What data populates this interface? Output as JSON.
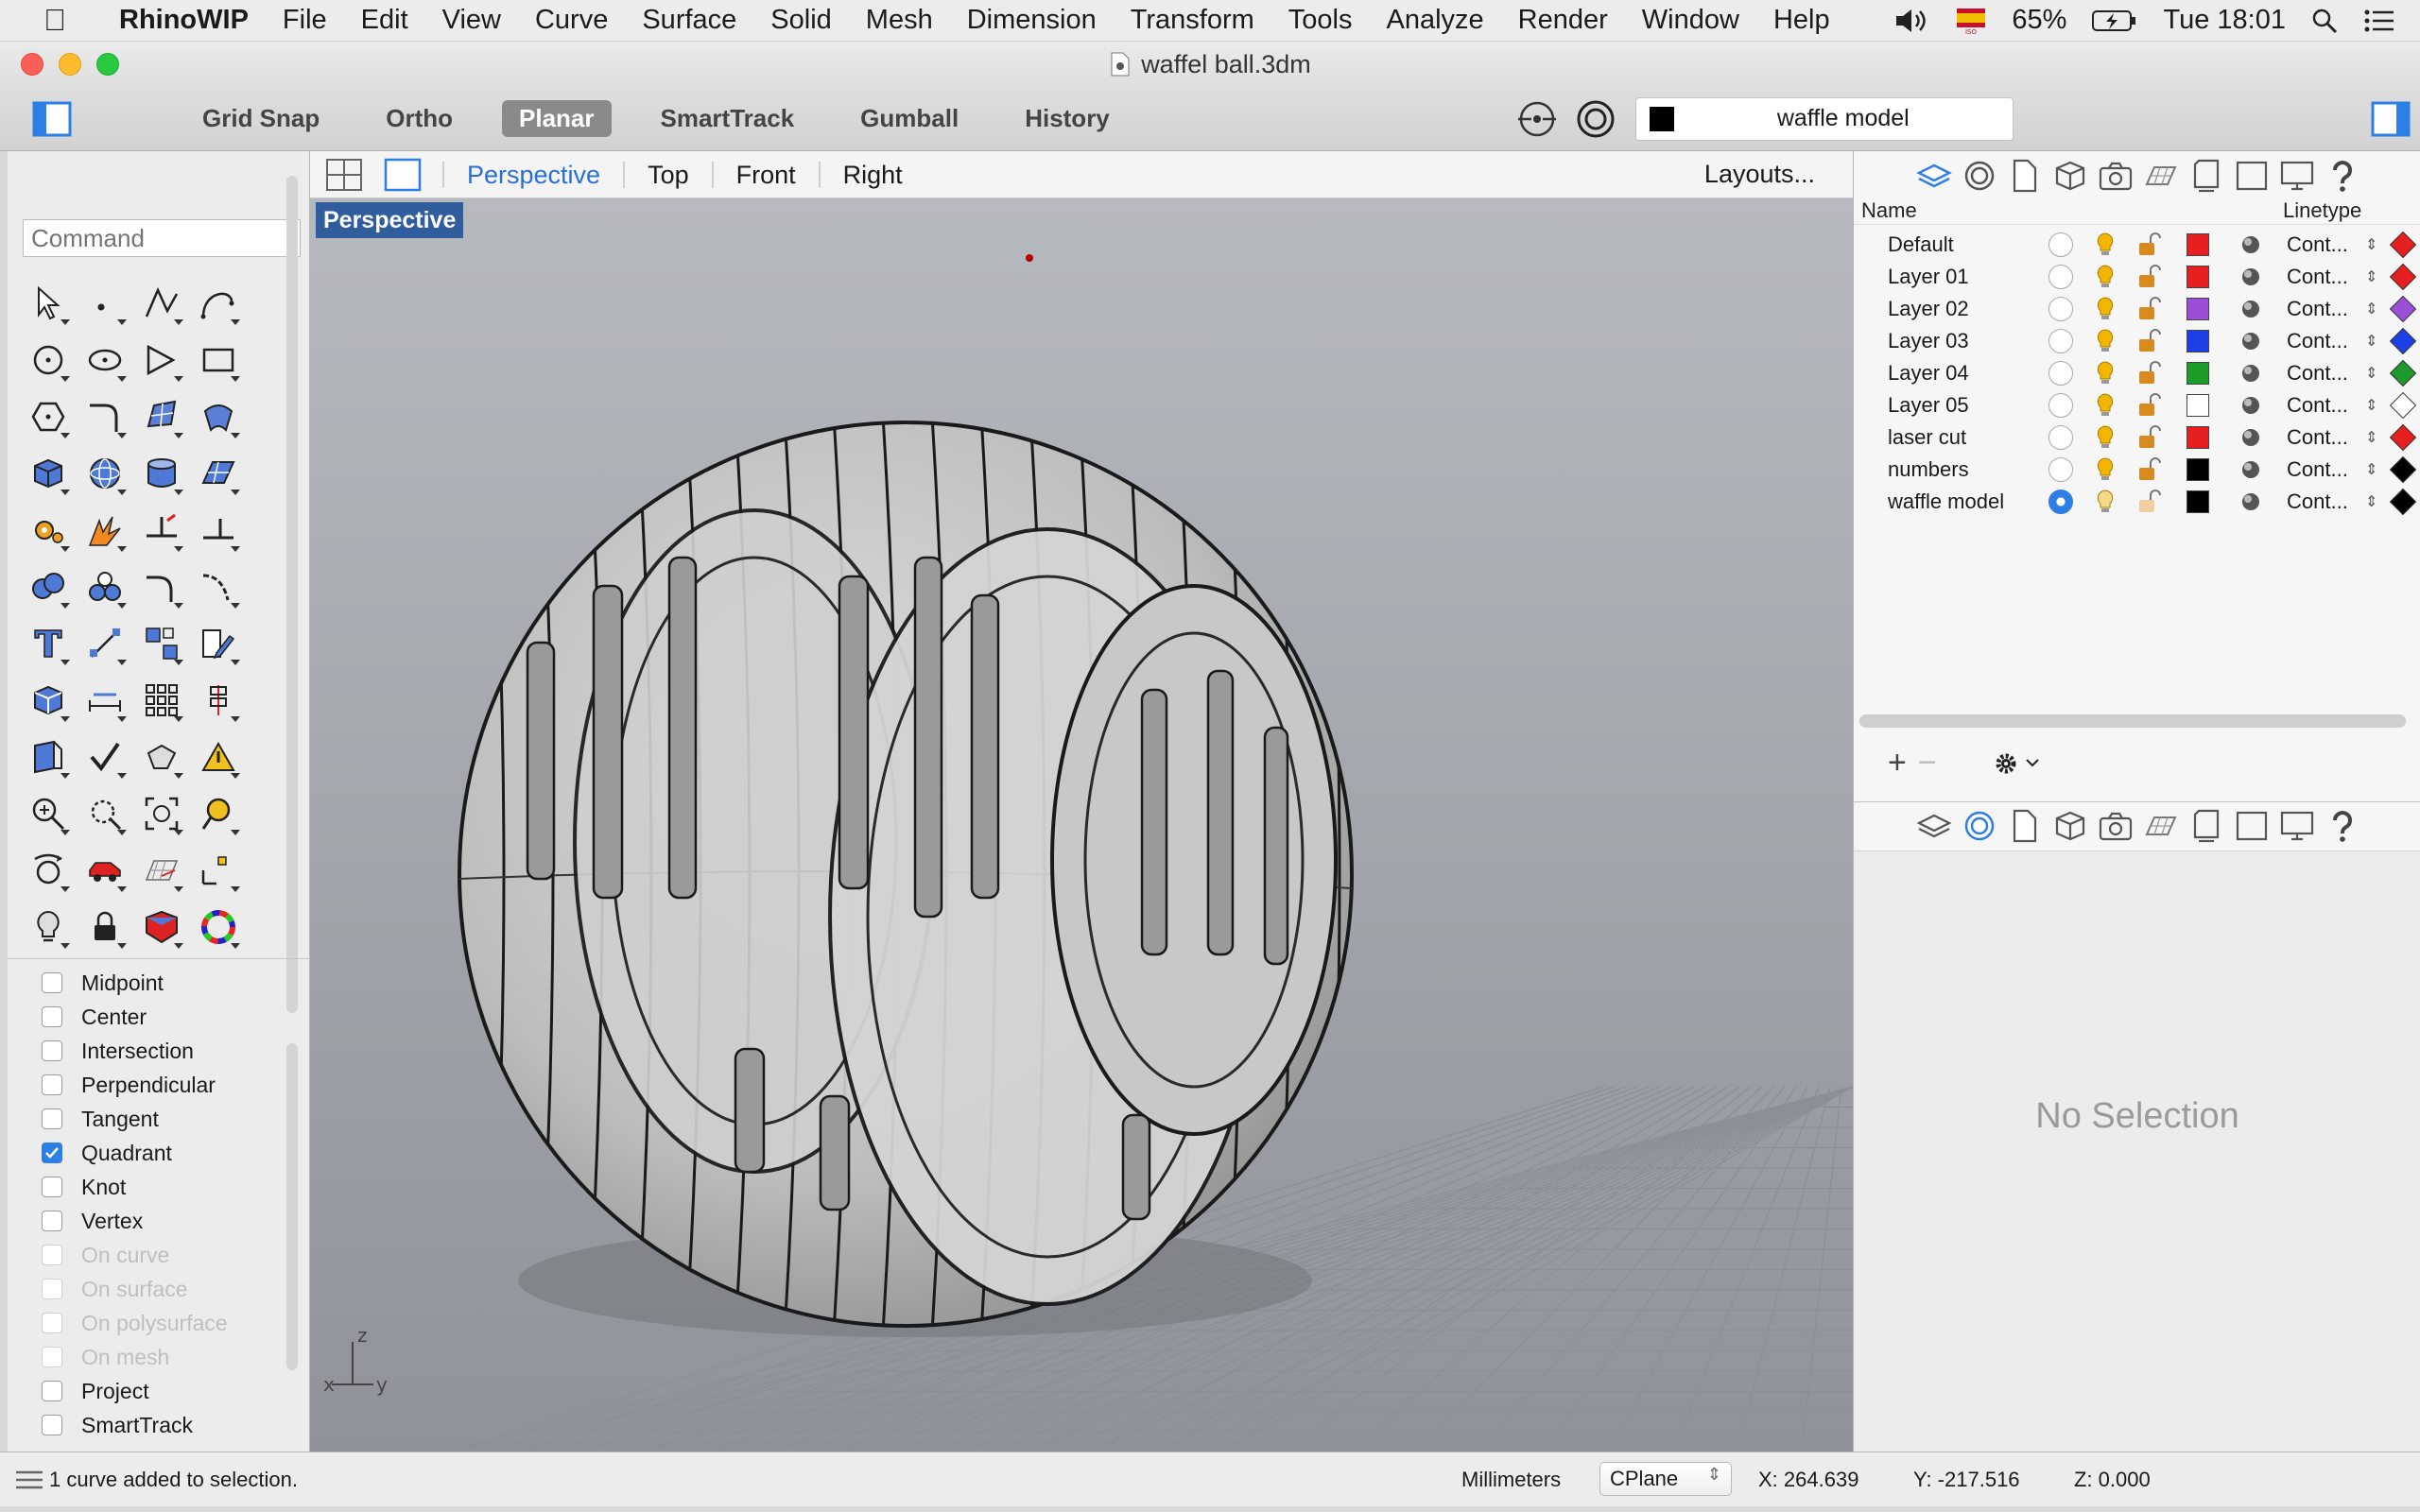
{
  "menubar": {
    "app_name": "RhinoWIP",
    "items": [
      "File",
      "Edit",
      "View",
      "Curve",
      "Surface",
      "Solid",
      "Mesh",
      "Dimension",
      "Transform",
      "Tools",
      "Analyze",
      "Render",
      "Window",
      "Help"
    ],
    "battery": "65%",
    "clock": "Tue 18:01"
  },
  "window": {
    "title": "waffel ball.3dm"
  },
  "toolbar": {
    "buttons": [
      "Grid Snap",
      "Ortho",
      "Planar",
      "SmartTrack",
      "Gumball",
      "History"
    ],
    "active_button": "Planar",
    "current_layer": "waffle model"
  },
  "command": {
    "placeholder": "Command"
  },
  "viewtabs": {
    "tabs": [
      "Perspective",
      "Top",
      "Front",
      "Right"
    ],
    "active": "Perspective",
    "layouts": "Layouts..."
  },
  "viewport": {
    "label": "Perspective",
    "axes": {
      "x": "x",
      "y": "y",
      "z": "z"
    }
  },
  "osnaps": [
    {
      "label": "Midpoint",
      "checked": false,
      "enabled": true
    },
    {
      "label": "Center",
      "checked": false,
      "enabled": true
    },
    {
      "label": "Intersection",
      "checked": false,
      "enabled": true
    },
    {
      "label": "Perpendicular",
      "checked": false,
      "enabled": true
    },
    {
      "label": "Tangent",
      "checked": false,
      "enabled": true
    },
    {
      "label": "Quadrant",
      "checked": true,
      "enabled": true
    },
    {
      "label": "Knot",
      "checked": false,
      "enabled": true
    },
    {
      "label": "Vertex",
      "checked": false,
      "enabled": true
    },
    {
      "label": "On curve",
      "checked": false,
      "enabled": false
    },
    {
      "label": "On surface",
      "checked": false,
      "enabled": false
    },
    {
      "label": "On polysurface",
      "checked": false,
      "enabled": false
    },
    {
      "label": "On mesh",
      "checked": false,
      "enabled": false
    },
    {
      "label": "Project",
      "checked": false,
      "enabled": true
    },
    {
      "label": "SmartTrack",
      "checked": false,
      "enabled": true
    }
  ],
  "layers": {
    "columns": {
      "name": "Name",
      "linetype": "Linetype"
    },
    "rows": [
      {
        "name": "Default",
        "color": "#e62020",
        "linetype": "Cont...",
        "current": false
      },
      {
        "name": "Layer 01",
        "color": "#e62020",
        "linetype": "Cont...",
        "current": false
      },
      {
        "name": "Layer 02",
        "color": "#9a4fd6",
        "linetype": "Cont...",
        "current": false
      },
      {
        "name": "Layer 03",
        "color": "#1f3fe6",
        "linetype": "Cont...",
        "current": false
      },
      {
        "name": "Layer 04",
        "color": "#1c9a2a",
        "linetype": "Cont...",
        "current": false
      },
      {
        "name": "Layer 05",
        "color": "#ffffff",
        "linetype": "Cont...",
        "current": false
      },
      {
        "name": "laser cut",
        "color": "#e62020",
        "linetype": "Cont...",
        "current": false
      },
      {
        "name": "numbers",
        "color": "#000000",
        "linetype": "Cont...",
        "current": false
      },
      {
        "name": "waffle model",
        "color": "#000000",
        "linetype": "Cont...",
        "current": true
      }
    ]
  },
  "properties": {
    "empty_text": "No Selection"
  },
  "statusbar": {
    "message": "1 curve added to selection.",
    "units": "Millimeters",
    "cplane": "CPlane",
    "x": "X: 264.639",
    "y": "Y: -217.516",
    "z": "Z: 0.000"
  },
  "colors": {
    "accent": "#2d7fe6",
    "viewport_bg": "#a5a8ad",
    "label_bg": "#2f5d9e"
  }
}
